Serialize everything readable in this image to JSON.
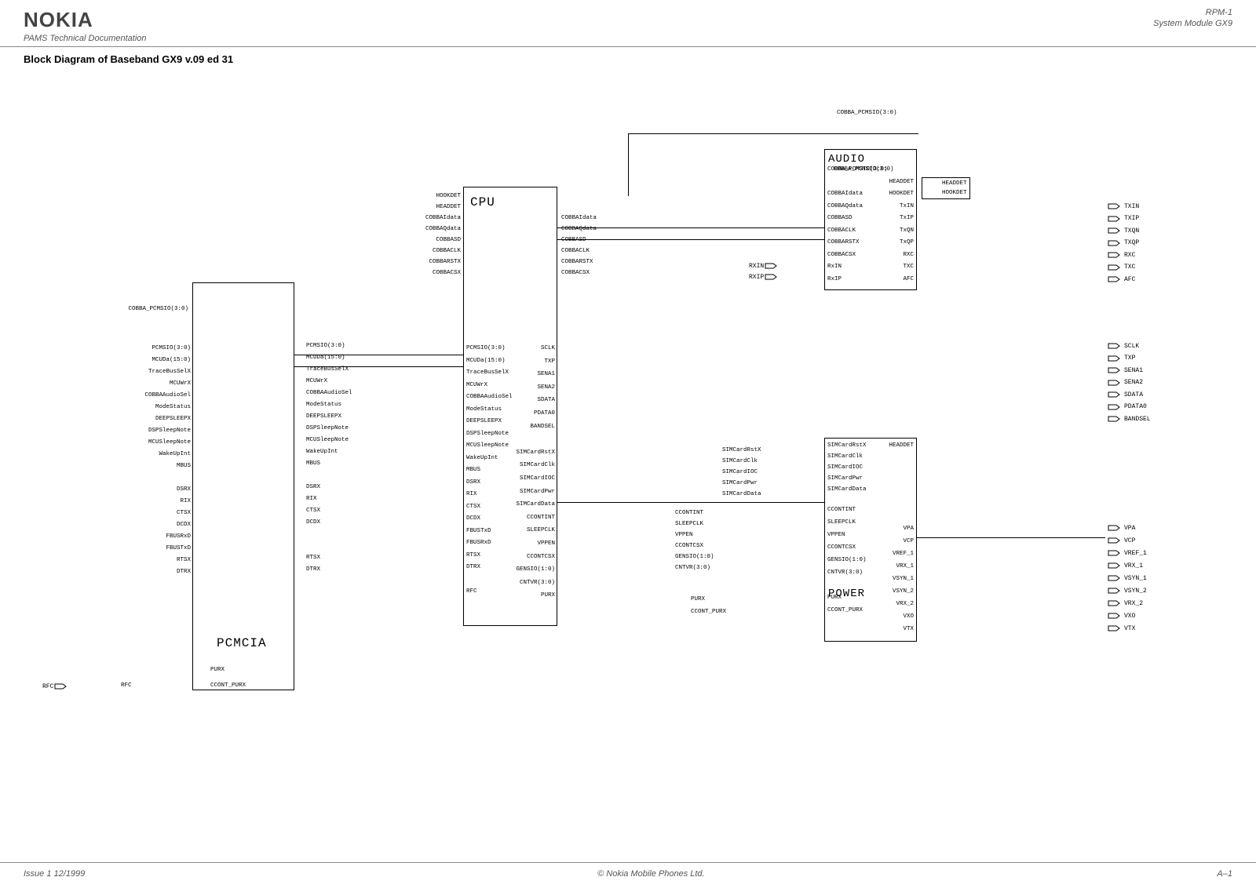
{
  "header": {
    "logo": "NOKIA",
    "subtitle": "PAMS Technical Documentation",
    "rpm": "RPM-1",
    "module": "System Module GX9"
  },
  "title": "Block Diagram of Baseband GX9 v.09 ed 31",
  "blocks": {
    "pcmcia": "PCMCIA",
    "cpu": "CPU",
    "audio": "AUDIO",
    "power": "POWER"
  },
  "top_labels": {
    "cobba_bus": "COBBA_PCMSIO(3:0)",
    "cobba_bus2": "COBBA_PCMSIO(3:0)"
  },
  "pcmcia_left_header": "COBBA_PCMSIO(3:0)",
  "pcmcia_left": [
    "PCMSIO(3:0)",
    "MCUDa(15:0)",
    "TraceBusSelX",
    "MCUWrX",
    "COBBAAudioSel",
    "ModeStatus",
    "DEEPSLEEPX",
    "DSPSleepNote",
    "MCUSleepNote",
    "WakeUpInt",
    "MBUS",
    "DSRX",
    "RIX",
    "CTSX",
    "DCDX",
    "FBUSRxD",
    "FBUSTxD",
    "RTSX",
    "DTRX"
  ],
  "pcmcia_bus": [
    "PCMSIO(3:0)",
    "MCUDa(15:0)",
    "TraceBusSelX",
    "MCUWrX",
    "COBBAAudioSel",
    "ModeStatus",
    "DEEPSLEEPX",
    "DSPSleepNote",
    "MCUSleepNote",
    "WakeUpInt",
    "MBUS",
    "DSRX",
    "RIX",
    "CTSX",
    "DCDX",
    "",
    "",
    "RTSX",
    "DTRX"
  ],
  "pcmcia_bottom": [
    "PURX",
    "CCONT_PURX"
  ],
  "pcmcia_rfc": "RFC",
  "rfc_port": "RFC",
  "cpu_upper_left": [
    "HOOKDET",
    "HEADDET",
    "COBBAIdata",
    "COBBAQdata",
    "COBBASD",
    "COBBACLK",
    "COBBARSTX",
    "COBBACSX"
  ],
  "cpu_upper_right": [
    "COBBAIdata",
    "COBBAQdata",
    "COBBASD",
    "COBBACLK",
    "COBBARSTX",
    "COBBACSX"
  ],
  "cpu_mid_left": [
    "PCMSIO(3:0)",
    "MCUDa(15:0)",
    "TraceBusSelX",
    "MCUWrX",
    "COBBAAudioSel",
    "ModeStatus",
    "DEEPSLEEPX",
    "DSPSleepNote",
    "MCUSleepNote",
    "WakeUpInt",
    "MBUS",
    "DSRX",
    "RIX",
    "CTSX",
    "DCDX",
    "FBUSTxD",
    "FBUSRxD",
    "RTSX",
    "DTRX",
    "",
    "RFC"
  ],
  "cpu_mid_right": [
    "SCLK",
    "TXP",
    "SENA1",
    "SENA2",
    "SDATA",
    "PDATA0",
    "BANDSEL",
    "",
    "SIMCardRstX",
    "SIMCardClk",
    "SIMCardIOC",
    "SIMCardPwr",
    "SIMCardData",
    "CCONTINT",
    "SLEEPCLK",
    "VPPEN",
    "CCONTCSX",
    "GENSIO(1:0)",
    "CNTVR(3:0)",
    "PURX"
  ],
  "rxin": "RXIN",
  "rxip": "RXIP",
  "mid_bus": [
    "CCONTINT",
    "SLEEPCLK",
    "VPPEN",
    "CCONTCSX",
    "GENSIO(1:0)",
    "CNTVR(3:0)"
  ],
  "mid_bus2": [
    "PURX",
    "CCONT_PURX"
  ],
  "mid_sim": [
    "SIMCardRstX",
    "SIMCardClk",
    "SIMCardIOC",
    "SIMCardPwr",
    "SIMCardData"
  ],
  "audio_left": [
    "COBBA_PCMSIO(3:0)",
    "",
    "COBBAIdata",
    "COBBAQdata",
    "COBBASD",
    "COBBACLK",
    "COBBARSTX",
    "COBBACSX",
    "RxIN",
    "RxIP"
  ],
  "audio_right": [
    "",
    "HEADDET",
    "HOOKDET",
    "TxIN",
    "TxIP",
    "TxQN",
    "TxQP",
    "RXC",
    "TXC",
    "AFC"
  ],
  "audio_inner": "AUDIO",
  "audio_headdet": "HEADDET",
  "audio_hookdet": "HOOKDET",
  "power_upper_left": [
    "SIMCardRstX",
    "SIMCardClk",
    "SIMCardIOC",
    "SIMCardPwr",
    "SIMCardData"
  ],
  "power_lower_left": [
    "CCONTINT",
    "SLEEPCLK",
    "VPPEN",
    "CCONTCSX",
    "GENSIO(1:0)",
    "CNTVR(3:0)",
    "",
    "PURX",
    "CCONT_PURX"
  ],
  "power_upper_right": [
    "HEADDET"
  ],
  "power_lower_right": [
    "VPA",
    "VCP",
    "VREF_1",
    "VRX_1",
    "VSYN_1",
    "VSYN_2",
    "VRX_2",
    "VXO",
    "VTX"
  ],
  "ports_right_upper": [
    "TXIN",
    "TXIP",
    "TXQN",
    "TXQP",
    "RXC",
    "TXC",
    "AFC"
  ],
  "ports_right_mid": [
    "SCLK",
    "TXP",
    "SENA1",
    "SENA2",
    "SDATA",
    "PDATA0",
    "BANDSEL"
  ],
  "ports_right_lower": [
    "VPA",
    "VCP",
    "VREF_1",
    "VRX_1",
    "VSYN_1",
    "VSYN_2",
    "VRX_2",
    "VXO",
    "VTX"
  ],
  "footer": {
    "issue": "Issue 1 12/1999",
    "copyright": "© Nokia Mobile Phones Ltd.",
    "page": "A–1"
  }
}
